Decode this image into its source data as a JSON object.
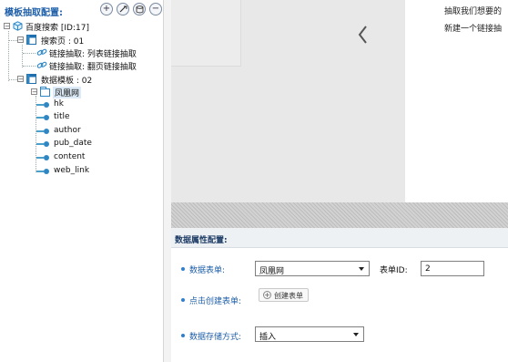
{
  "left_panel": {
    "title": "模板抽取配置:",
    "toolbar": [
      {
        "icon": "add-icon",
        "glyph": "+"
      },
      {
        "icon": "link-edit-icon",
        "glyph": ""
      },
      {
        "icon": "database-icon",
        "glyph": ""
      },
      {
        "icon": "remove-icon",
        "glyph": "−"
      }
    ],
    "tree": {
      "root": {
        "label": "百度搜索 [ID:17]",
        "expander": "−"
      },
      "search_page": {
        "label": "搜索页 : 01",
        "expander": "−"
      },
      "link_list": {
        "label": "链接抽取: 列表链接抽取"
      },
      "link_page": {
        "label": "链接抽取: 翻页链接抽取"
      },
      "data_template": {
        "label": "数据模板 : 02",
        "expander": "−"
      },
      "fenghuang": {
        "label": "凤凰网",
        "expander": "−"
      },
      "fields": [
        "hk",
        "title",
        "author",
        "pub_date",
        "content",
        "web_link"
      ]
    }
  },
  "preview": {
    "nav_icon": "chevron-left-icon",
    "lines": [
      "抽取我们想要的",
      "新建一个链接抽"
    ]
  },
  "config": {
    "title": "数据属性配置:",
    "data_table_label": "数据表单:",
    "data_table_value": "凤凰网",
    "table_id_label": "表单ID:",
    "table_id_value": "2",
    "create_label": "点击创建表单:",
    "create_button": "创建表单",
    "storage_label": "数据存储方式:",
    "storage_value": "插入"
  },
  "colors": {
    "accent": "#1f5fa8",
    "tree_icon": "#2a86c6",
    "bullet": "#2f7fd0"
  }
}
